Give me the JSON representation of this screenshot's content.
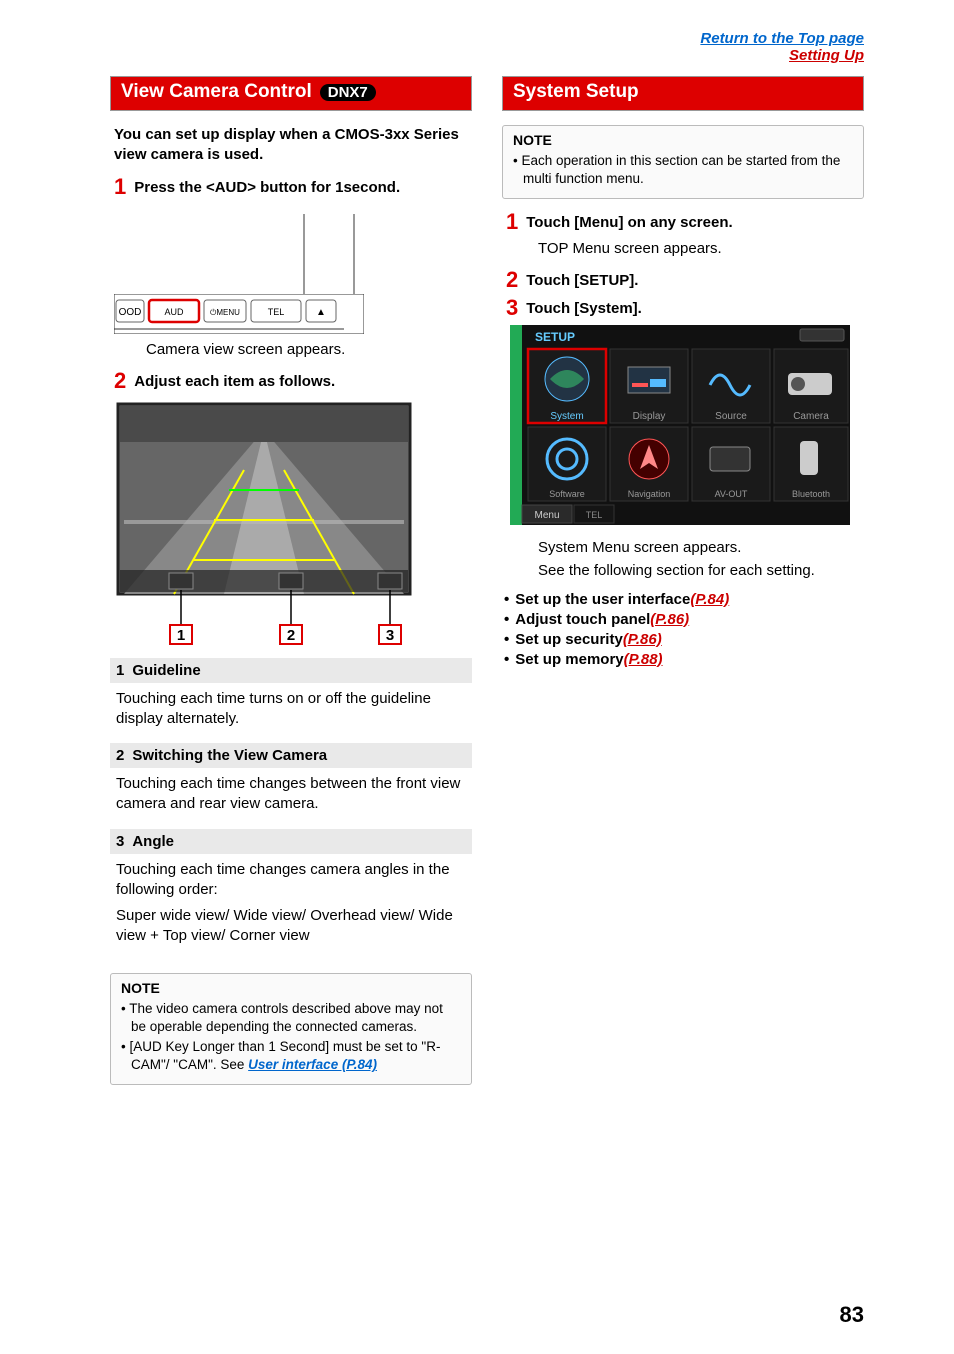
{
  "header": {
    "return_link": "Return to the Top page",
    "section_link": "Setting Up"
  },
  "left": {
    "title": "View Camera Control",
    "badge": "DNX7",
    "intro": "You can set up display when a CMOS-3xx Series view camera is used.",
    "step1_num": "1",
    "step1_text": "Press the <AUD> button for 1second.",
    "step1_result": "Camera view screen appears.",
    "step2_num": "2",
    "step2_text": "Adjust each item as follows.",
    "callout1": "1",
    "callout2": "2",
    "callout3": "3",
    "item1_head_num": "1",
    "item1_head_text": "Guideline",
    "item1_body": "Touching each time turns on or off the guideline display alternately.",
    "item2_head_num": "2",
    "item2_head_text": "Switching the View Camera",
    "item2_body": "Touching each time changes between the front view camera and rear view camera.",
    "item3_head_num": "3",
    "item3_head_text": "Angle",
    "item3_body1": "Touching each time changes camera angles in the following order:",
    "item3_body2": "Super wide view/ Wide view/ Overhead view/ Wide view + Top view/ Corner view",
    "note_title": "NOTE",
    "note1": "The video camera controls described above may not be operable depending the connected cameras.",
    "note2a": "[AUD Key Longer than 1 Second] must be set to \"R-CAM\"/ \"CAM\". See ",
    "note2_link": "User interface (P.84)"
  },
  "right": {
    "title": "System Setup",
    "note_title": "NOTE",
    "note1": "Each operation in this section can be started from the multi function menu.",
    "step1_num": "1",
    "step1_text": "Touch [Menu] on any screen.",
    "step1_result": "TOP Menu screen appears.",
    "step2_num": "2",
    "step2_text": "Touch [SETUP].",
    "step3_num": "3",
    "step3_text": "Touch [System].",
    "step3_result1": "System Menu screen appears.",
    "step3_result2": "See the following section for each setting.",
    "bullets": [
      {
        "text": "Set up the user interface ",
        "link": "(P.84)"
      },
      {
        "text": "Adjust touch panel ",
        "link": "(P.86)"
      },
      {
        "text": "Set up security ",
        "link": "(P.86)"
      },
      {
        "text": "Set up memory ",
        "link": "(P.88)"
      }
    ]
  },
  "page_num": "83",
  "icons": {
    "panel": {
      "aud": "AUD",
      "menu": "MENU",
      "tel": "TEL",
      "eject": "⏏",
      "ood": "OOD"
    },
    "setup": {
      "title": "SETUP",
      "system": "System",
      "display": "Display",
      "source": "Source",
      "camera": "Camera",
      "software": "Software",
      "navigation": "Navigation",
      "avout": "AV-OUT",
      "bluetooth": "Bluetooth",
      "menu": "Menu",
      "tel": "TEL"
    }
  }
}
